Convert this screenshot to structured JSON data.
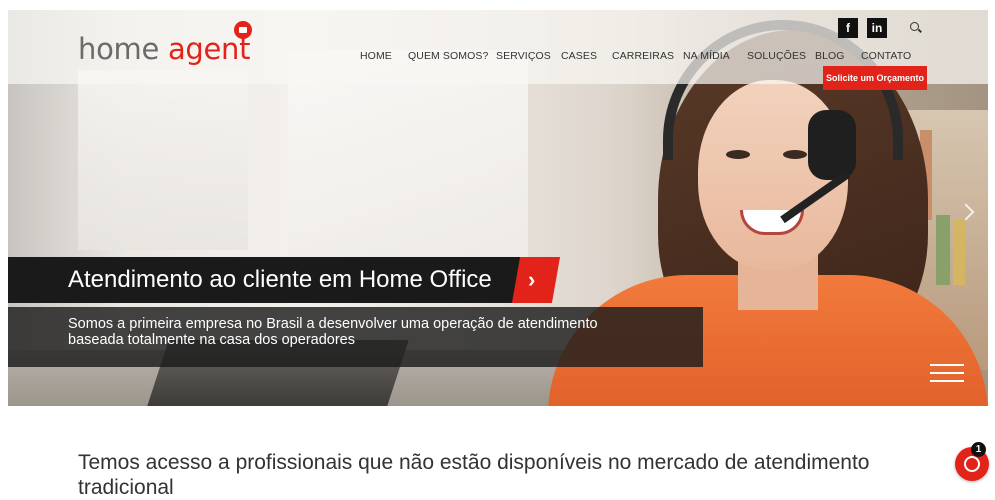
{
  "brand": {
    "word1": "home",
    "word2": "agent",
    "accent": "#e2231a"
  },
  "nav": {
    "items": [
      "HOME",
      "QUEM SOMOS?",
      "SERVIÇOS",
      "CASES",
      "CARREIRAS",
      "NA MÍDIA",
      "SOLUÇÕES",
      "BLOG",
      "CONTATO"
    ],
    "cta": "Solicite um Orçamento"
  },
  "social": {
    "facebook": "f",
    "linkedin": "in"
  },
  "hero": {
    "title": "Atendimento ao cliente em Home Office",
    "arrow": "›",
    "subtitle_line1": "Somos a primeira empresa no Brasil a desenvolver uma operação de atendimento",
    "subtitle_line2": "baseada totalmente na casa dos operadores"
  },
  "section": {
    "headline": "Temos acesso a profissionais que não estão disponíveis no mercado de atendimento tradicional"
  },
  "chat": {
    "badge": "1"
  },
  "icons": [
    "search-icon",
    "facebook-icon",
    "linkedin-icon",
    "chat-bubble-icon",
    "menu-icon",
    "chevron-right-icon"
  ]
}
